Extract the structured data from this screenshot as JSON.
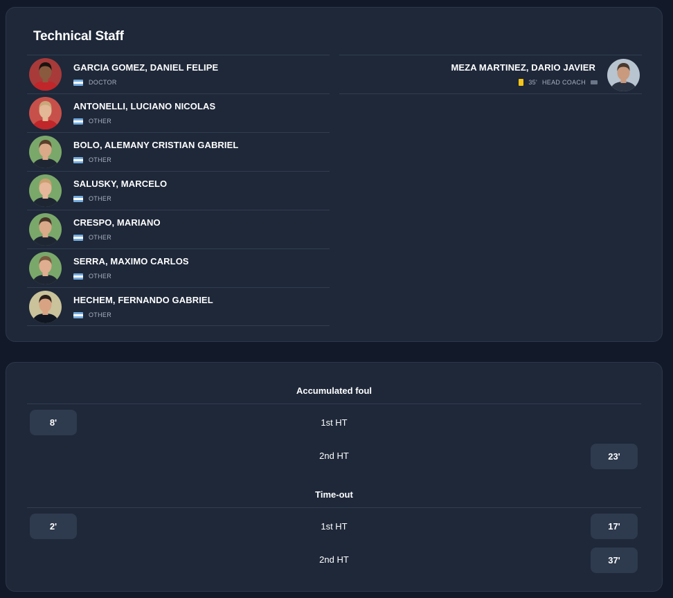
{
  "technical_staff": {
    "title": "Technical Staff",
    "home": [
      {
        "name": "GARCIA GOMEZ, DANIEL FELIPE",
        "role": "DOCTOR",
        "skin": "#8a5a3e",
        "hair": "#1a1410",
        "bg": "#a83a3a",
        "shirt": "#c0262a"
      },
      {
        "name": "ANTONELLI, LUCIANO NICOLAS",
        "role": "OTHER",
        "skin": "#e2b896",
        "hair": "#c9a87a",
        "bg": "#c8504a",
        "shirt": "#c0262a"
      },
      {
        "name": "BOLO, ALEMANY CRISTIAN GABRIEL",
        "role": "OTHER",
        "skin": "#d9a98a",
        "hair": "#5a3e2b",
        "bg": "#7aa86a",
        "shirt": "#1f2633"
      },
      {
        "name": "SALUSKY, MARCELO",
        "role": "OTHER",
        "skin": "#e6b79a",
        "hair": "#c9a070",
        "bg": "#7aa86a",
        "shirt": "#1f2633"
      },
      {
        "name": "CRESPO, MARIANO",
        "role": "OTHER",
        "skin": "#d9a98a",
        "hair": "#4a3526",
        "bg": "#7aa86a",
        "shirt": "#1f2633"
      },
      {
        "name": "SERRA, MAXIMO CARLOS",
        "role": "OTHER",
        "skin": "#dfae90",
        "hair": "#7a5a3e",
        "bg": "#7aa86a",
        "shirt": "#1f2633"
      },
      {
        "name": "HECHEM, FERNANDO GABRIEL",
        "role": "OTHER",
        "skin": "#d8a383",
        "hair": "#2a1f18",
        "bg": "#c9c29a",
        "shirt": "#111722"
      }
    ],
    "away": [
      {
        "name": "MEZA MARTINEZ, DARIO JAVIER",
        "card_minute": "35'",
        "role": "HEAD COACH",
        "skin": "#c99a7e",
        "hair": "#4a3a2e",
        "bg": "#b8c4cf",
        "shirt": "#2a3342"
      }
    ]
  },
  "accumulated_foul": {
    "title": "Accumulated foul",
    "first_half_label": "1st HT",
    "second_half_label": "2nd HT",
    "home_first": "8'",
    "away_second": "23'"
  },
  "time_out": {
    "title": "Time-out",
    "first_half_label": "1st HT",
    "second_half_label": "2nd HT",
    "home_first": "2'",
    "away_first": "17'",
    "away_second": "37'"
  },
  "colors": {
    "background": "#121a29",
    "card": "#1e2839",
    "chip": "#2e3a4d",
    "yellow_card": "#f5c518"
  }
}
